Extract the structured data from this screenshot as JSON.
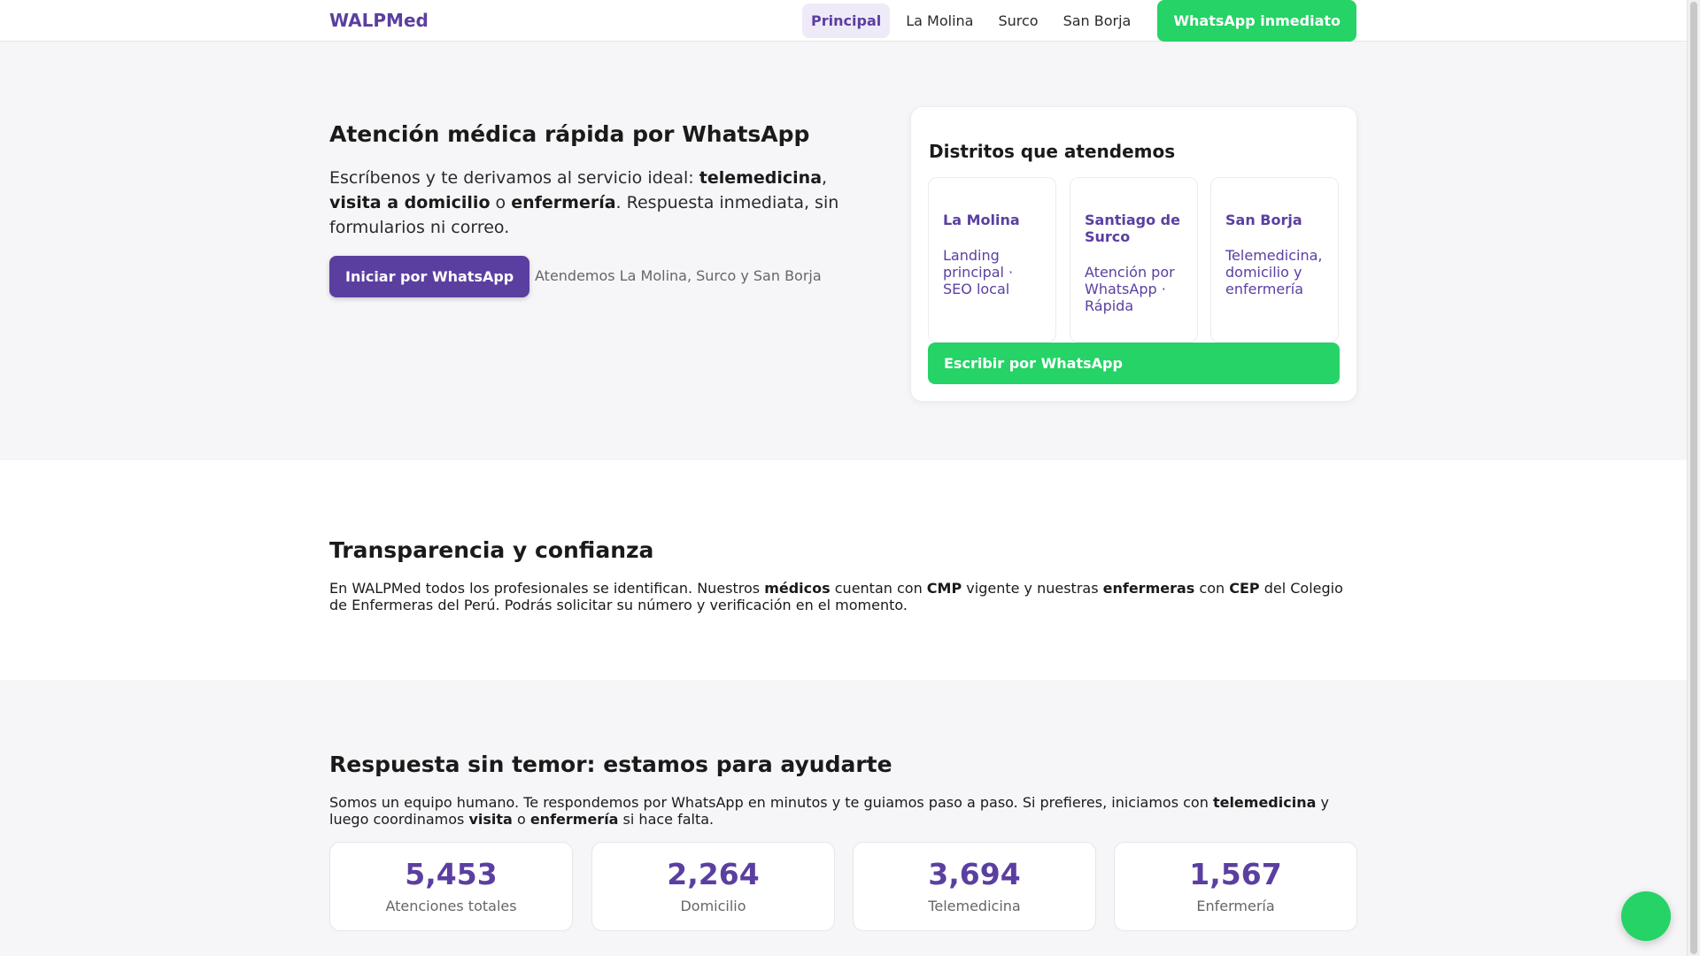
{
  "header": {
    "brand": "WALPMed",
    "nav": [
      {
        "label": "Principal"
      },
      {
        "label": "La Molina"
      },
      {
        "label": "Surco"
      },
      {
        "label": "San Borja"
      }
    ],
    "cta_label": "WhatsApp inmediato"
  },
  "hero": {
    "title": "Atención médica rápida por WhatsApp",
    "desc_1": "Escríbenos y te derivamos al servicio ideal: ",
    "desc_b1": "telemedicina",
    "desc_2": ", ",
    "desc_b2": "visita a domicilio",
    "desc_3": " o ",
    "desc_b3": "enfermería",
    "desc_4": ". Respuesta inmediata, sin formularios ni correo.",
    "button_label": "Iniciar por WhatsApp",
    "note": "Atendemos La Molina, Surco y San Borja"
  },
  "districts": {
    "title": "Distritos que atendemos",
    "items": [
      {
        "name": "La Molina",
        "desc": "Landing principal · SEO local"
      },
      {
        "name": "Santiago de Surco",
        "desc": "Atención por WhatsApp · Rápida"
      },
      {
        "name": "San Borja",
        "desc": "Telemedicina, domicilio y enfermería"
      }
    ],
    "cta_label": "Escribir por WhatsApp"
  },
  "transparency": {
    "title": "Transparencia y confianza",
    "t1": "En WALPMed todos los profesionales se identifican. Nuestros ",
    "b1": "médicos",
    "t2": " cuentan con ",
    "b2": "CMP",
    "t3": " vigente y nuestras ",
    "b3": "enfermeras",
    "t4": " con ",
    "b4": "CEP",
    "t5": " del Colegio de Enfermeras del Perú. Podrás solicitar su número y verificación en el momento."
  },
  "response": {
    "title": "Respuesta sin temor: estamos para ayudarte",
    "t1": "Somos un equipo humano. Te respondemos por WhatsApp en minutos y te guiamos paso a paso. Si prefieres, iniciamos con ",
    "b1": "telemedicina",
    "t2": " y luego coordinamos ",
    "b2": "visita",
    "t3": " o ",
    "b3": "enfermería",
    "t4": " si hace falta."
  },
  "stats": [
    {
      "value": "5,453",
      "label": "Atenciones totales"
    },
    {
      "value": "2,264",
      "label": "Domicilio"
    },
    {
      "value": "3,694",
      "label": "Telemedicina"
    },
    {
      "value": "1,567",
      "label": "Enfermería"
    }
  ],
  "colors": {
    "brand": "#5b3fa0",
    "whatsapp": "#25d366"
  }
}
